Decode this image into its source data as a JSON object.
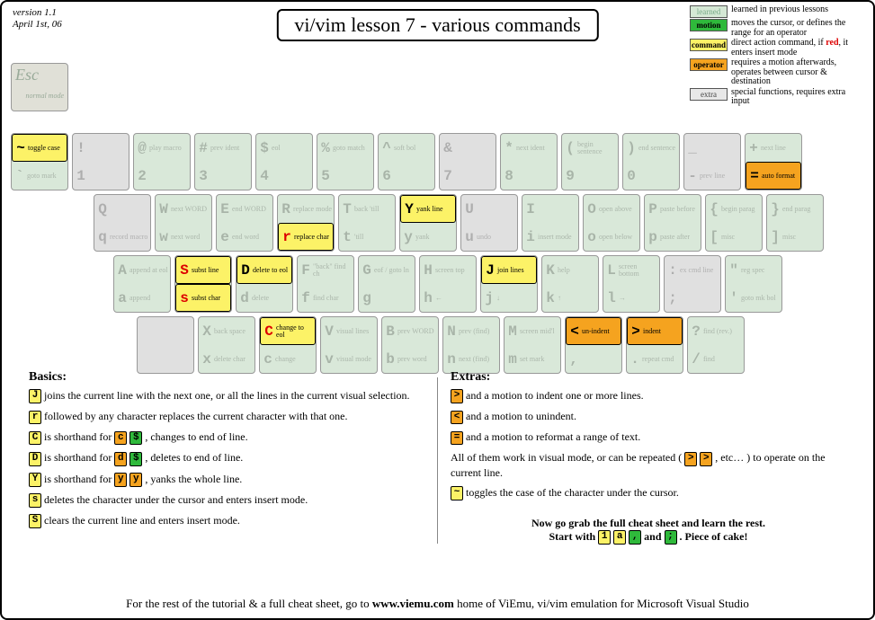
{
  "version": {
    "line1": "version 1.1",
    "line2": "April 1st, 06"
  },
  "title": "vi/vim lesson 7 - various commands",
  "legend": {
    "learned": {
      "chip": "learned",
      "text": "learned in previous lessons"
    },
    "motion": {
      "chip": "motion",
      "text": "moves the cursor, or defines the range for an operator"
    },
    "command": {
      "chip": "command",
      "text_before": "direct action command, if ",
      "red": "red",
      "text_after": ", it enters insert mode"
    },
    "operator": {
      "chip": "operator",
      "text": "requires a motion afterwards, operates between cursor & destination"
    },
    "extra": {
      "chip": "extra",
      "text": "special functions, requires extra input"
    }
  },
  "esc": {
    "glyph": "Esc",
    "lbl": "normal mode"
  },
  "rows": {
    "num": [
      {
        "u": {
          "g": "~",
          "l": "toggle case",
          "cls": "command"
        },
        "d": {
          "g": "`",
          "l": "goto mark",
          "cls": "faded"
        }
      },
      {
        "u": {
          "g": "!",
          "l": "",
          "cls": "faded"
        },
        "d": {
          "g": "1",
          "l": "",
          "cls": "faded"
        },
        "gray": true
      },
      {
        "u": {
          "g": "@",
          "l": "play macro",
          "cls": "faded"
        },
        "d": {
          "g": "2",
          "l": "",
          "cls": "faded"
        }
      },
      {
        "u": {
          "g": "#",
          "l": "prev ident",
          "cls": "faded"
        },
        "d": {
          "g": "3",
          "l": "",
          "cls": "faded"
        }
      },
      {
        "u": {
          "g": "$",
          "l": "eol",
          "cls": "faded"
        },
        "d": {
          "g": "4",
          "l": "",
          "cls": "faded"
        }
      },
      {
        "u": {
          "g": "%",
          "l": "goto match",
          "cls": "faded"
        },
        "d": {
          "g": "5",
          "l": "",
          "cls": "faded"
        }
      },
      {
        "u": {
          "g": "^",
          "l": "soft bol",
          "cls": "faded"
        },
        "d": {
          "g": "6",
          "l": "",
          "cls": "faded"
        }
      },
      {
        "u": {
          "g": "&",
          "l": "",
          "cls": "faded"
        },
        "d": {
          "g": "7",
          "l": "",
          "cls": "faded"
        },
        "gray": true
      },
      {
        "u": {
          "g": "*",
          "l": "next ident",
          "cls": "faded"
        },
        "d": {
          "g": "8",
          "l": "",
          "cls": "faded"
        }
      },
      {
        "u": {
          "g": "(",
          "l": "begin sentence",
          "cls": "faded"
        },
        "d": {
          "g": "9",
          "l": "",
          "cls": "faded"
        }
      },
      {
        "u": {
          "g": ")",
          "l": "end sentence",
          "cls": "faded"
        },
        "d": {
          "g": "0",
          "l": "",
          "cls": "faded"
        }
      },
      {
        "u": {
          "g": "_",
          "l": "",
          "cls": "faded"
        },
        "d": {
          "g": "-",
          "l": "prev line",
          "cls": "faded"
        },
        "gray": true
      },
      {
        "u": {
          "g": "+",
          "l": "next line",
          "cls": "faded"
        },
        "d": {
          "g": "=",
          "l": "auto format",
          "cls": "operator"
        }
      }
    ],
    "qwe": [
      {
        "u": {
          "g": "Q",
          "l": "",
          "cls": "faded"
        },
        "d": {
          "g": "q",
          "l": "record macro",
          "cls": "faded"
        },
        "gray": true
      },
      {
        "u": {
          "g": "W",
          "l": "next WORD",
          "cls": "faded"
        },
        "d": {
          "g": "w",
          "l": "next word",
          "cls": "faded"
        }
      },
      {
        "u": {
          "g": "E",
          "l": "end WORD",
          "cls": "faded"
        },
        "d": {
          "g": "e",
          "l": "end word",
          "cls": "faded"
        }
      },
      {
        "u": {
          "g": "R",
          "l": "replace mode",
          "cls": "faded"
        },
        "d": {
          "g": "r",
          "l": "replace char",
          "cls": "command",
          "red": true
        }
      },
      {
        "u": {
          "g": "T",
          "l": "back 'till",
          "cls": "faded"
        },
        "d": {
          "g": "t",
          "l": "'till",
          "cls": "faded"
        }
      },
      {
        "u": {
          "g": "Y",
          "l": "yank line",
          "cls": "command"
        },
        "d": {
          "g": "y",
          "l": "yank",
          "cls": "faded"
        }
      },
      {
        "u": {
          "g": "U",
          "l": "",
          "cls": "faded"
        },
        "d": {
          "g": "u",
          "l": "undo",
          "cls": "faded"
        },
        "gray": true
      },
      {
        "u": {
          "g": "I",
          "l": "",
          "cls": "faded"
        },
        "d": {
          "g": "i",
          "l": "insert mode",
          "cls": "faded"
        }
      },
      {
        "u": {
          "g": "O",
          "l": "open above",
          "cls": "faded"
        },
        "d": {
          "g": "o",
          "l": "open below",
          "cls": "faded"
        }
      },
      {
        "u": {
          "g": "P",
          "l": "paste before",
          "cls": "faded"
        },
        "d": {
          "g": "p",
          "l": "paste after",
          "cls": "faded"
        }
      },
      {
        "u": {
          "g": "{",
          "l": "begin parag",
          "cls": "faded"
        },
        "d": {
          "g": "[",
          "l": "misc",
          "cls": "faded"
        }
      },
      {
        "u": {
          "g": "}",
          "l": "end parag",
          "cls": "faded"
        },
        "d": {
          "g": "]",
          "l": "misc",
          "cls": "faded"
        }
      }
    ],
    "asd": [
      {
        "u": {
          "g": "A",
          "l": "append at eol",
          "cls": "faded"
        },
        "d": {
          "g": "a",
          "l": "append",
          "cls": "faded"
        }
      },
      {
        "u": {
          "g": "S",
          "l": "subst line",
          "cls": "command",
          "red": true
        },
        "d": {
          "g": "s",
          "l": "subst char",
          "cls": "command",
          "red": true
        }
      },
      {
        "u": {
          "g": "D",
          "l": "delete to eol",
          "cls": "command"
        },
        "d": {
          "g": "d",
          "l": "delete",
          "cls": "faded"
        }
      },
      {
        "u": {
          "g": "F",
          "l": "\"back\" find ch",
          "cls": "faded"
        },
        "d": {
          "g": "f",
          "l": "find char",
          "cls": "faded"
        }
      },
      {
        "u": {
          "g": "G",
          "l": "eof / goto ln",
          "cls": "faded"
        },
        "d": {
          "g": "g",
          "l": "",
          "cls": "faded"
        }
      },
      {
        "u": {
          "g": "H",
          "l": "screen top",
          "cls": "faded"
        },
        "d": {
          "g": "h",
          "l": "←",
          "cls": "faded"
        }
      },
      {
        "u": {
          "g": "J",
          "l": "join lines",
          "cls": "command"
        },
        "d": {
          "g": "j",
          "l": "↓",
          "cls": "faded"
        }
      },
      {
        "u": {
          "g": "K",
          "l": "help",
          "cls": "faded"
        },
        "d": {
          "g": "k",
          "l": "↑",
          "cls": "faded"
        }
      },
      {
        "u": {
          "g": "L",
          "l": "screen bottom",
          "cls": "faded"
        },
        "d": {
          "g": "l",
          "l": "→",
          "cls": "faded"
        }
      },
      {
        "u": {
          "g": ":",
          "l": "ex cmd line",
          "cls": "faded"
        },
        "d": {
          "g": ";",
          "l": "",
          "cls": "faded"
        },
        "gray": true
      },
      {
        "u": {
          "g": "\"",
          "l": "reg spec",
          "cls": "faded"
        },
        "d": {
          "g": "'",
          "l": "goto mk bol",
          "cls": "faded"
        }
      }
    ],
    "zxc": [
      {
        "u": {
          "g": "",
          "l": "",
          "cls": "faded"
        },
        "d": {
          "g": "",
          "l": "",
          "cls": "faded"
        },
        "gray": true
      },
      {
        "u": {
          "g": "X",
          "l": "back space",
          "cls": "faded"
        },
        "d": {
          "g": "x",
          "l": "delete char",
          "cls": "faded"
        }
      },
      {
        "u": {
          "g": "C",
          "l": "change to eol",
          "cls": "command",
          "red": true
        },
        "d": {
          "g": "c",
          "l": "change",
          "cls": "faded"
        }
      },
      {
        "u": {
          "g": "V",
          "l": "visual lines",
          "cls": "faded"
        },
        "d": {
          "g": "v",
          "l": "visual mode",
          "cls": "faded"
        }
      },
      {
        "u": {
          "g": "B",
          "l": "prev WORD",
          "cls": "faded"
        },
        "d": {
          "g": "b",
          "l": "prev word",
          "cls": "faded"
        }
      },
      {
        "u": {
          "g": "N",
          "l": "prev (find)",
          "cls": "faded"
        },
        "d": {
          "g": "n",
          "l": "next (find)",
          "cls": "faded"
        }
      },
      {
        "u": {
          "g": "M",
          "l": "screen mid'l",
          "cls": "faded"
        },
        "d": {
          "g": "m",
          "l": "set mark",
          "cls": "faded"
        }
      },
      {
        "u": {
          "g": "<",
          "l": "un-indent",
          "cls": "operator"
        },
        "d": {
          "g": ",",
          "l": "",
          "cls": "faded"
        }
      },
      {
        "u": {
          "g": ">",
          "l": "indent",
          "cls": "operator"
        },
        "d": {
          "g": ".",
          "l": "repeat cmd",
          "cls": "faded"
        }
      },
      {
        "u": {
          "g": "?",
          "l": "find (rev.)",
          "cls": "faded"
        },
        "d": {
          "g": "/",
          "l": "find",
          "cls": "faded"
        }
      }
    ]
  },
  "basics": {
    "heading": "Basics:",
    "J": "joins the current line with the next one, or all the lines in the current visual selection.",
    "r": "followed by any character replaces the current character with that one.",
    "C": {
      "pre": "is shorthand for",
      "c1": "c",
      "c2": "$",
      "post": ", changes to end of line."
    },
    "D": {
      "pre": "is shorthand for",
      "c1": "d",
      "c2": "$",
      "post": ", deletes to end of line."
    },
    "Y": {
      "pre": "is shorthand for",
      "c1": "y",
      "c2": "y",
      "post": ", yanks the whole line."
    },
    "s": "deletes the character under the cursor and enters insert mode.",
    "S": "clears the current line and enters insert mode."
  },
  "extras": {
    "heading": "Extras:",
    "gt": "and a motion to indent one or more lines.",
    "lt": "and a motion to unindent.",
    "eq": "and a motion to reformat a range of text.",
    "all": {
      "pre": "All of them work in visual mode, or can be repeated (",
      "c1": ">",
      "c2": ">",
      "post": ", etc… ) to operate on the current line."
    },
    "tilde": "toggles the case of the character under the cursor.",
    "cta_line1": "Now go grab the full cheat sheet and learn the rest.",
    "cta_line2": {
      "pre": "Start with",
      "c1": "1",
      "c2": "a",
      "c3": ",",
      "mid": "and",
      "c4": ";",
      "post": ".  Piece of cake!"
    }
  },
  "footer": {
    "pre": "For the rest of the tutorial & a full cheat sheet, go to ",
    "link": "www.viemu.com",
    "post": " home of ViEmu, vi/vim emulation for Microsoft Visual Studio"
  }
}
